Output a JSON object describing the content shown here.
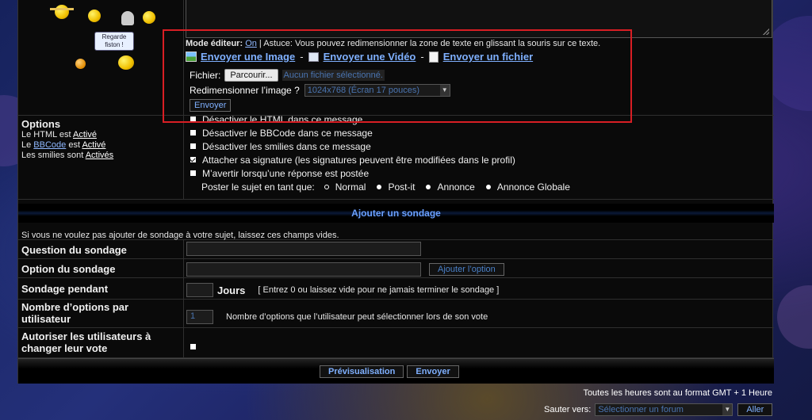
{
  "smilies_bubble": "Regarde fiston !",
  "editor": {
    "mode_label": "Mode éditeur:",
    "mode_value": "On",
    "tip": " | Astuce: Vous pouvez redimensionner la zone de texte en glissant la souris sur ce texte.",
    "send_image": "Envoyer une Image",
    "send_video": "Envoyer une Vidéo",
    "send_file": "Envoyer un fichier",
    "sep": "-",
    "file_label": "Fichier:",
    "browse_button": "Parcourir...",
    "no_file": "Aucun fichier sélectionné.",
    "resize_label": "Redimensionner l’image ?",
    "resize_value": "1024x768 (Écran 17 pouces)",
    "upload_button": "Envoyer"
  },
  "options": {
    "title": "Options",
    "html_prefix": "Le HTML est ",
    "html_state": "Activé",
    "bbcode_prefix": "Le ",
    "bbcode_link": "BBCode",
    "bbcode_mid": " est ",
    "bbcode_state": "Activé",
    "smilies_prefix": "Les smilies sont ",
    "smilies_state": "Activés",
    "items": [
      "Désactiver le HTML dans ce message",
      "Désactiver le BBCode dans ce message",
      "Désactiver les smilies dans ce message",
      "Attacher sa signature (les signatures peuvent être modifiées dans le profil)",
      "M’avertir lorsqu’une réponse est postée"
    ],
    "post_as_label": "Poster le sujet en tant que:",
    "post_types": [
      "Normal",
      "Post-it",
      "Annonce",
      "Annonce Globale"
    ]
  },
  "poll": {
    "section_title": "Ajouter un sondage",
    "info": "Si vous ne voulez pas ajouter de sondage à votre sujet, laissez ces champs vides.",
    "question_label": "Question du sondage",
    "option_label": "Option du sondage",
    "add_option_button": "Ajouter l’option",
    "duration_label": "Sondage pendant",
    "days_label": "Jours",
    "duration_hint": "[ Entrez 0 ou laissez vide pour ne jamais terminer le sondage ]",
    "options_per_user_label": "Nombre d’options par utilisateur",
    "options_per_user_value": "1",
    "options_per_user_hint": "Nombre d’options que l’utilisateur peut sélectionner lors de son vote",
    "allow_change_label": "Autoriser les utilisateurs à changer leur vote"
  },
  "footer": {
    "preview_button": "Prévisualisation",
    "submit_button": "Envoyer",
    "timezone": "Toutes les heures sont au format GMT + 1 Heure",
    "jump_label": "Sauter vers:",
    "jump_value": "Sélectionner un forum",
    "go_button": "Aller"
  },
  "colors": {
    "highlight": "#d81e24",
    "link": "#7fb0ff",
    "section": "#6aa0ff"
  }
}
